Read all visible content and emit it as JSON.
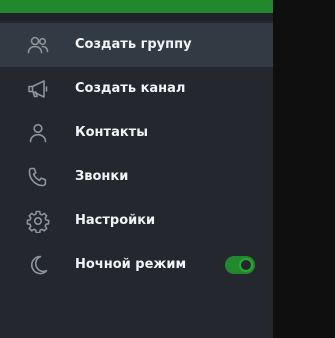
{
  "colors": {
    "accent": "#22882e",
    "drawer_bg": "#24282e",
    "active_bg": "#323b44",
    "text": "#f1f3f5",
    "icon": "#8d949b",
    "backdrop": "#0f0f10"
  },
  "menu": {
    "items": [
      {
        "label": "Создать группу",
        "icon": "people-icon",
        "active": true
      },
      {
        "label": "Создать канал",
        "icon": "megaphone-icon",
        "active": false
      },
      {
        "label": "Контакты",
        "icon": "person-icon",
        "active": false
      },
      {
        "label": "Звонки",
        "icon": "phone-icon",
        "active": false
      },
      {
        "label": "Настройки",
        "icon": "gear-icon",
        "active": false
      },
      {
        "label": "Ночной режим",
        "icon": "moon-icon",
        "active": false,
        "toggle": true,
        "toggle_on": true
      }
    ]
  }
}
